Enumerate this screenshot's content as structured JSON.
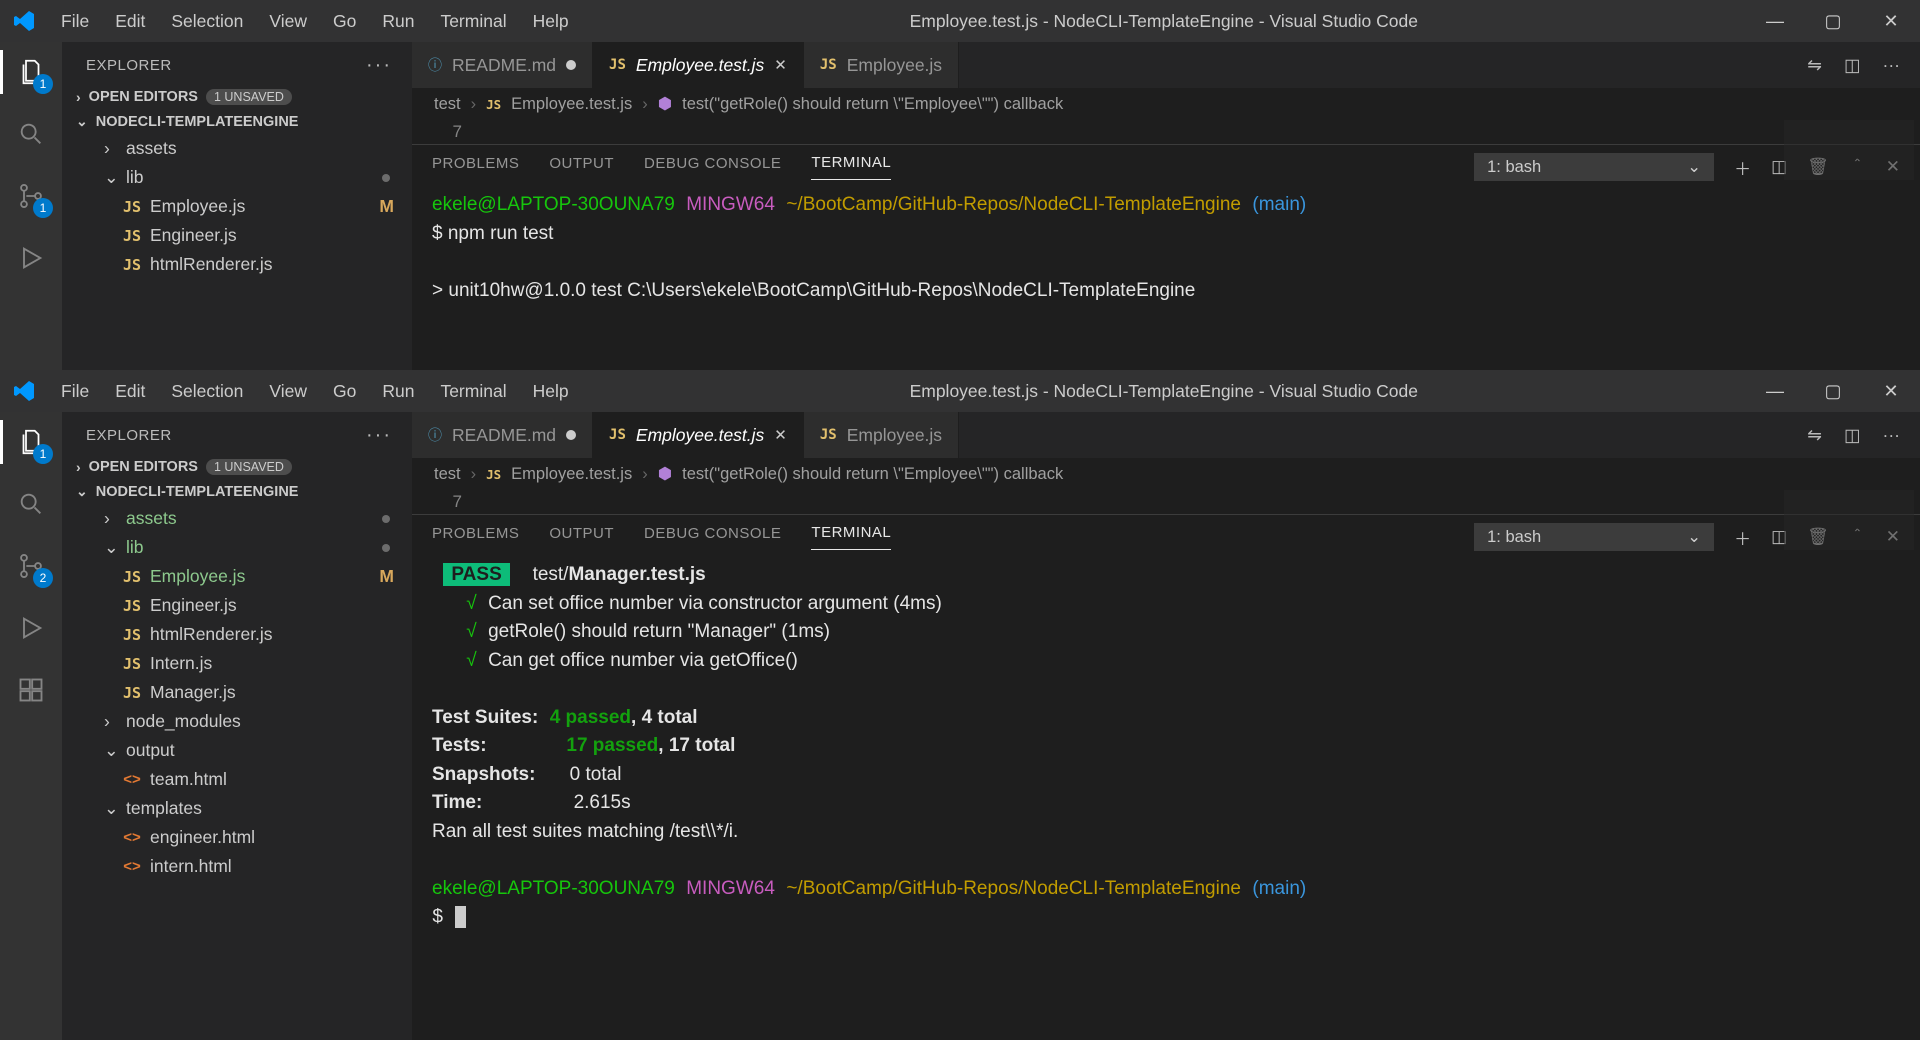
{
  "menus": [
    "File",
    "Edit",
    "Selection",
    "View",
    "Go",
    "Run",
    "Terminal",
    "Help"
  ],
  "title_top": "Employee.test.js - NodeCLI-TemplateEngine - Visual Studio Code",
  "title_bot": "Employee.test.js - NodeCLI-TemplateEngine - Visual Studio Code",
  "explorer_label": "EXPLORER",
  "open_editors": "OPEN EDITORS",
  "unsaved_badge": "1 UNSAVED",
  "project": "NODECLI-TEMPLATEENGINE",
  "badge_top": "1",
  "badge_bot": "2",
  "tree_top": [
    {
      "ind": 28,
      "chev": "›",
      "lbl": "assets"
    },
    {
      "ind": 28,
      "chev": "⌄",
      "lbl": "lib",
      "dot": true
    },
    {
      "ind": 46,
      "ic": "JS",
      "lbl": "Employee.js",
      "mod": "M"
    },
    {
      "ind": 46,
      "ic": "JS",
      "lbl": "Engineer.js"
    },
    {
      "ind": 46,
      "ic": "JS",
      "lbl": "htmlRenderer.js"
    }
  ],
  "tree_bot": [
    {
      "ind": 28,
      "chev": "›",
      "lbl": "assets",
      "green": true,
      "dot": true
    },
    {
      "ind": 28,
      "chev": "⌄",
      "lbl": "lib",
      "green": true,
      "dot": true
    },
    {
      "ind": 46,
      "ic": "JS",
      "lbl": "Employee.js",
      "mod": "M",
      "green": true
    },
    {
      "ind": 46,
      "ic": "JS",
      "lbl": "Engineer.js"
    },
    {
      "ind": 46,
      "ic": "JS",
      "lbl": "htmlRenderer.js"
    },
    {
      "ind": 46,
      "ic": "JS",
      "lbl": "Intern.js"
    },
    {
      "ind": 46,
      "ic": "JS",
      "lbl": "Manager.js"
    },
    {
      "ind": 28,
      "chev": "›",
      "lbl": "node_modules"
    },
    {
      "ind": 28,
      "chev": "⌄",
      "lbl": "output"
    },
    {
      "ind": 46,
      "ic": "<>",
      "lbl": "team.html"
    },
    {
      "ind": 28,
      "chev": "⌄",
      "lbl": "templates"
    },
    {
      "ind": 46,
      "ic": "<>",
      "lbl": "engineer.html"
    },
    {
      "ind": 46,
      "ic": "<>",
      "lbl": "intern.html"
    }
  ],
  "tabs": [
    {
      "ic": "ⓘ",
      "color": "#519aba",
      "lbl": "README.md",
      "dirty": true
    },
    {
      "ic": "JS",
      "color": "#e2c06d",
      "lbl": "Employee.test.js",
      "active": true,
      "italic": true,
      "close": true
    },
    {
      "ic": "JS",
      "color": "#e2c06d",
      "lbl": "Employee.js"
    }
  ],
  "crumb": {
    "a": "test",
    "b": "Employee.test.js",
    "c": "test(\"getRole() should return \\\"Employee\\\"\") callback"
  },
  "editor_line": "7",
  "panel_tabs": [
    "PROBLEMS",
    "OUTPUT",
    "DEBUG CONSOLE",
    "TERMINAL"
  ],
  "term_sel": "1: bash",
  "prompt": {
    "user": "ekele@LAPTOP-30OUNA79",
    "shell": "MINGW64",
    "path": "~/BootCamp/GitHub-Repos/NodeCLI-TemplateEngine",
    "branch": "(main)"
  },
  "top_term": {
    "cmd": "$ npm run test",
    "out1": "> unit10hw@1.0.0 test C:\\Users\\ekele\\BootCamp\\GitHub-Repos\\NodeCLI-TemplateEngine"
  },
  "bot_term": {
    "pass": "PASS",
    "file_a": "test/",
    "file_b": "Manager.test.js",
    "l1": "Can set office number via constructor argument (4ms)",
    "l2": "getRole() should return \"Manager\" (1ms)",
    "l3": "Can get office number via getOffice()",
    "suites_lbl": "Test Suites:",
    "suites_p": "4 passed",
    "suites_t": ", 4 total",
    "tests_lbl": "Tests:",
    "tests_p": "17 passed",
    "tests_t": ", 17 total",
    "snap_lbl": "Snapshots:",
    "snap_v": "0 total",
    "time_lbl": "Time:",
    "time_v": "2.615s",
    "ran": "Ran all test suites matching /test\\\\*/i."
  }
}
